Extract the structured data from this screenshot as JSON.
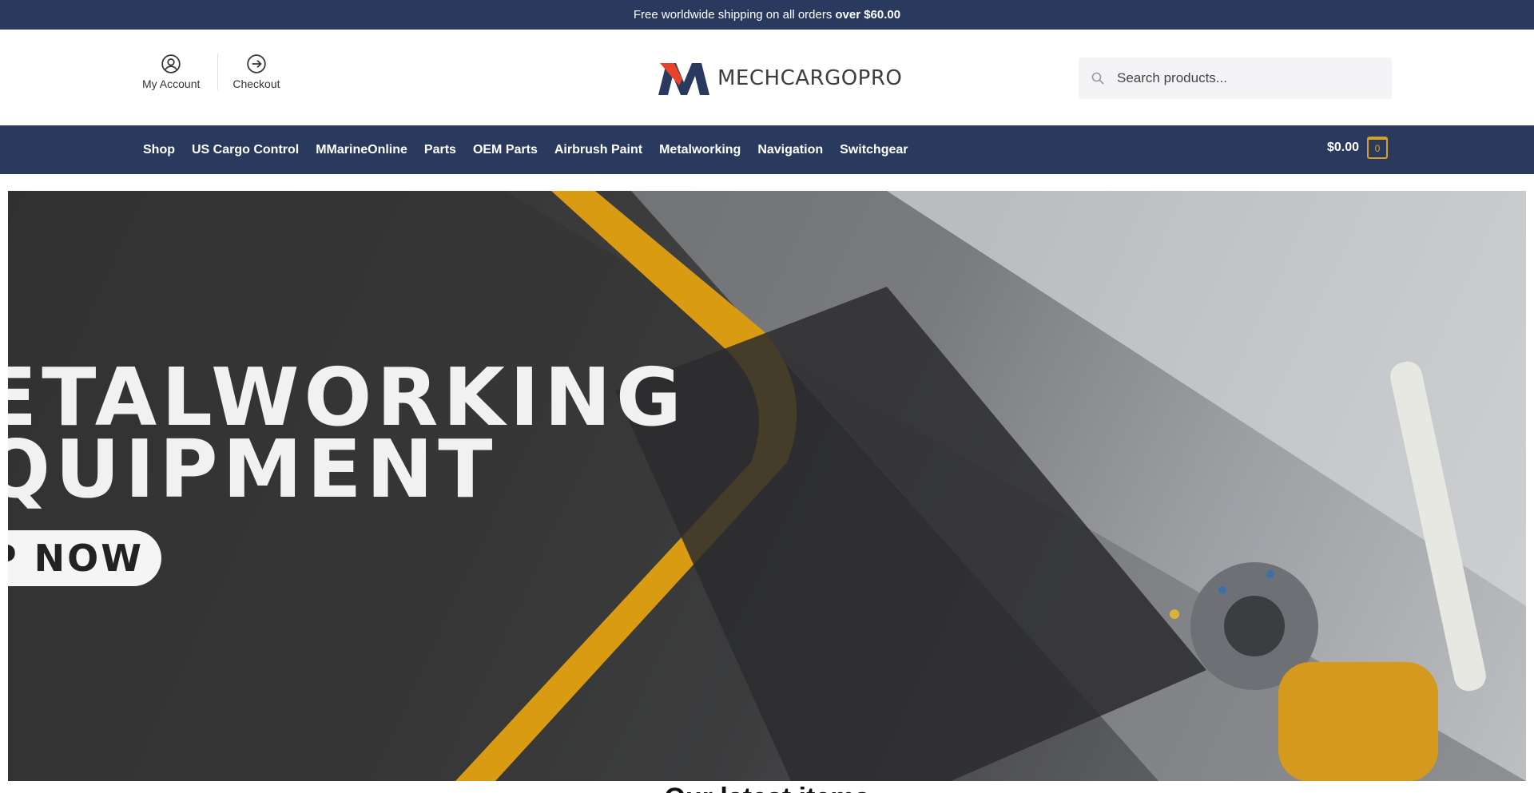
{
  "announcement": {
    "text": "Free worldwide shipping on all orders",
    "highlight": "over $60.00"
  },
  "header": {
    "account_links": [
      {
        "label": "My Account",
        "icon": "user-circle-icon"
      },
      {
        "label": "Checkout",
        "icon": "arrow-circle-right-icon"
      }
    ],
    "logo_text": "MECHCARGOPRO",
    "search": {
      "placeholder": "Search products...",
      "value": ""
    }
  },
  "nav": {
    "items": [
      "Shop",
      "US Cargo Control",
      "MMarineOnline",
      "Parts",
      "OEM Parts",
      "Airbrush Paint",
      "Metalworking",
      "Navigation",
      "Switchgear"
    ],
    "cart_total": "$0.00",
    "cart_count": "0"
  },
  "hero": {
    "line1": "ETALWORKING",
    "line2": "QUIPMENT",
    "button": "OP NOW"
  },
  "section_title": "Our latest items",
  "colors": {
    "navy": "#2a3a5f",
    "accent_gold": "#d7a21f",
    "logo_red": "#e8432a",
    "logo_navy": "#2a3a5f"
  }
}
